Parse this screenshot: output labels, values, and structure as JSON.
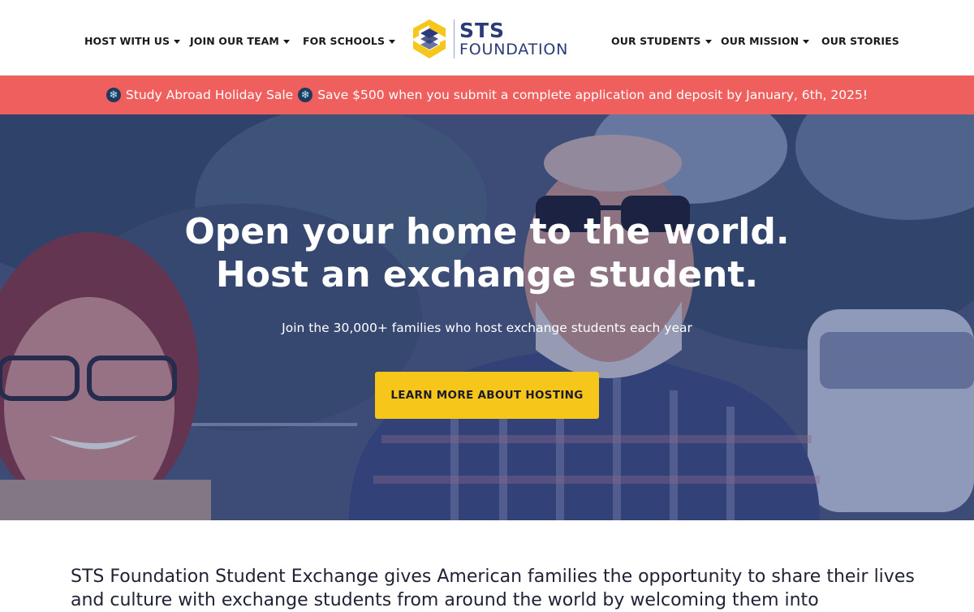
{
  "nav": {
    "left": [
      {
        "label": "HOST WITH US",
        "has_dropdown": true
      },
      {
        "label": "JOIN OUR TEAM",
        "has_dropdown": true
      },
      {
        "label": "FOR SCHOOLS",
        "has_dropdown": true
      }
    ],
    "right": [
      {
        "label": "OUR STUDENTS",
        "has_dropdown": true
      },
      {
        "label": "OUR MISSION",
        "has_dropdown": true
      },
      {
        "label": "OUR STORIES",
        "has_dropdown": false
      }
    ]
  },
  "logo": {
    "line1": "STS",
    "line2": "FOUNDATION",
    "icon": "sts-cube-logo-icon",
    "colors": {
      "yellow": "#f6c61b",
      "navy": "#2b3a78"
    }
  },
  "promo": {
    "sale_label": "Study Abroad Holiday Sale",
    "message": "Save $500 when you submit a complete application and deposit by January, 6th, 2025!",
    "icon": "snowflake-icon",
    "background": "#ee5f5d"
  },
  "hero": {
    "title_line1": "Open your home to the world.",
    "title_line2": "Host an exchange student.",
    "subtitle": "Join the 30,000+ families who host exchange students each year",
    "cta_label": "LEARN MORE ABOUT HOSTING",
    "cta_color": "#f6c61b"
  },
  "intro": {
    "text": "STS Foundation Student Exchange gives American families the opportunity to share their lives and culture with exchange students from around the world by welcoming them into"
  }
}
